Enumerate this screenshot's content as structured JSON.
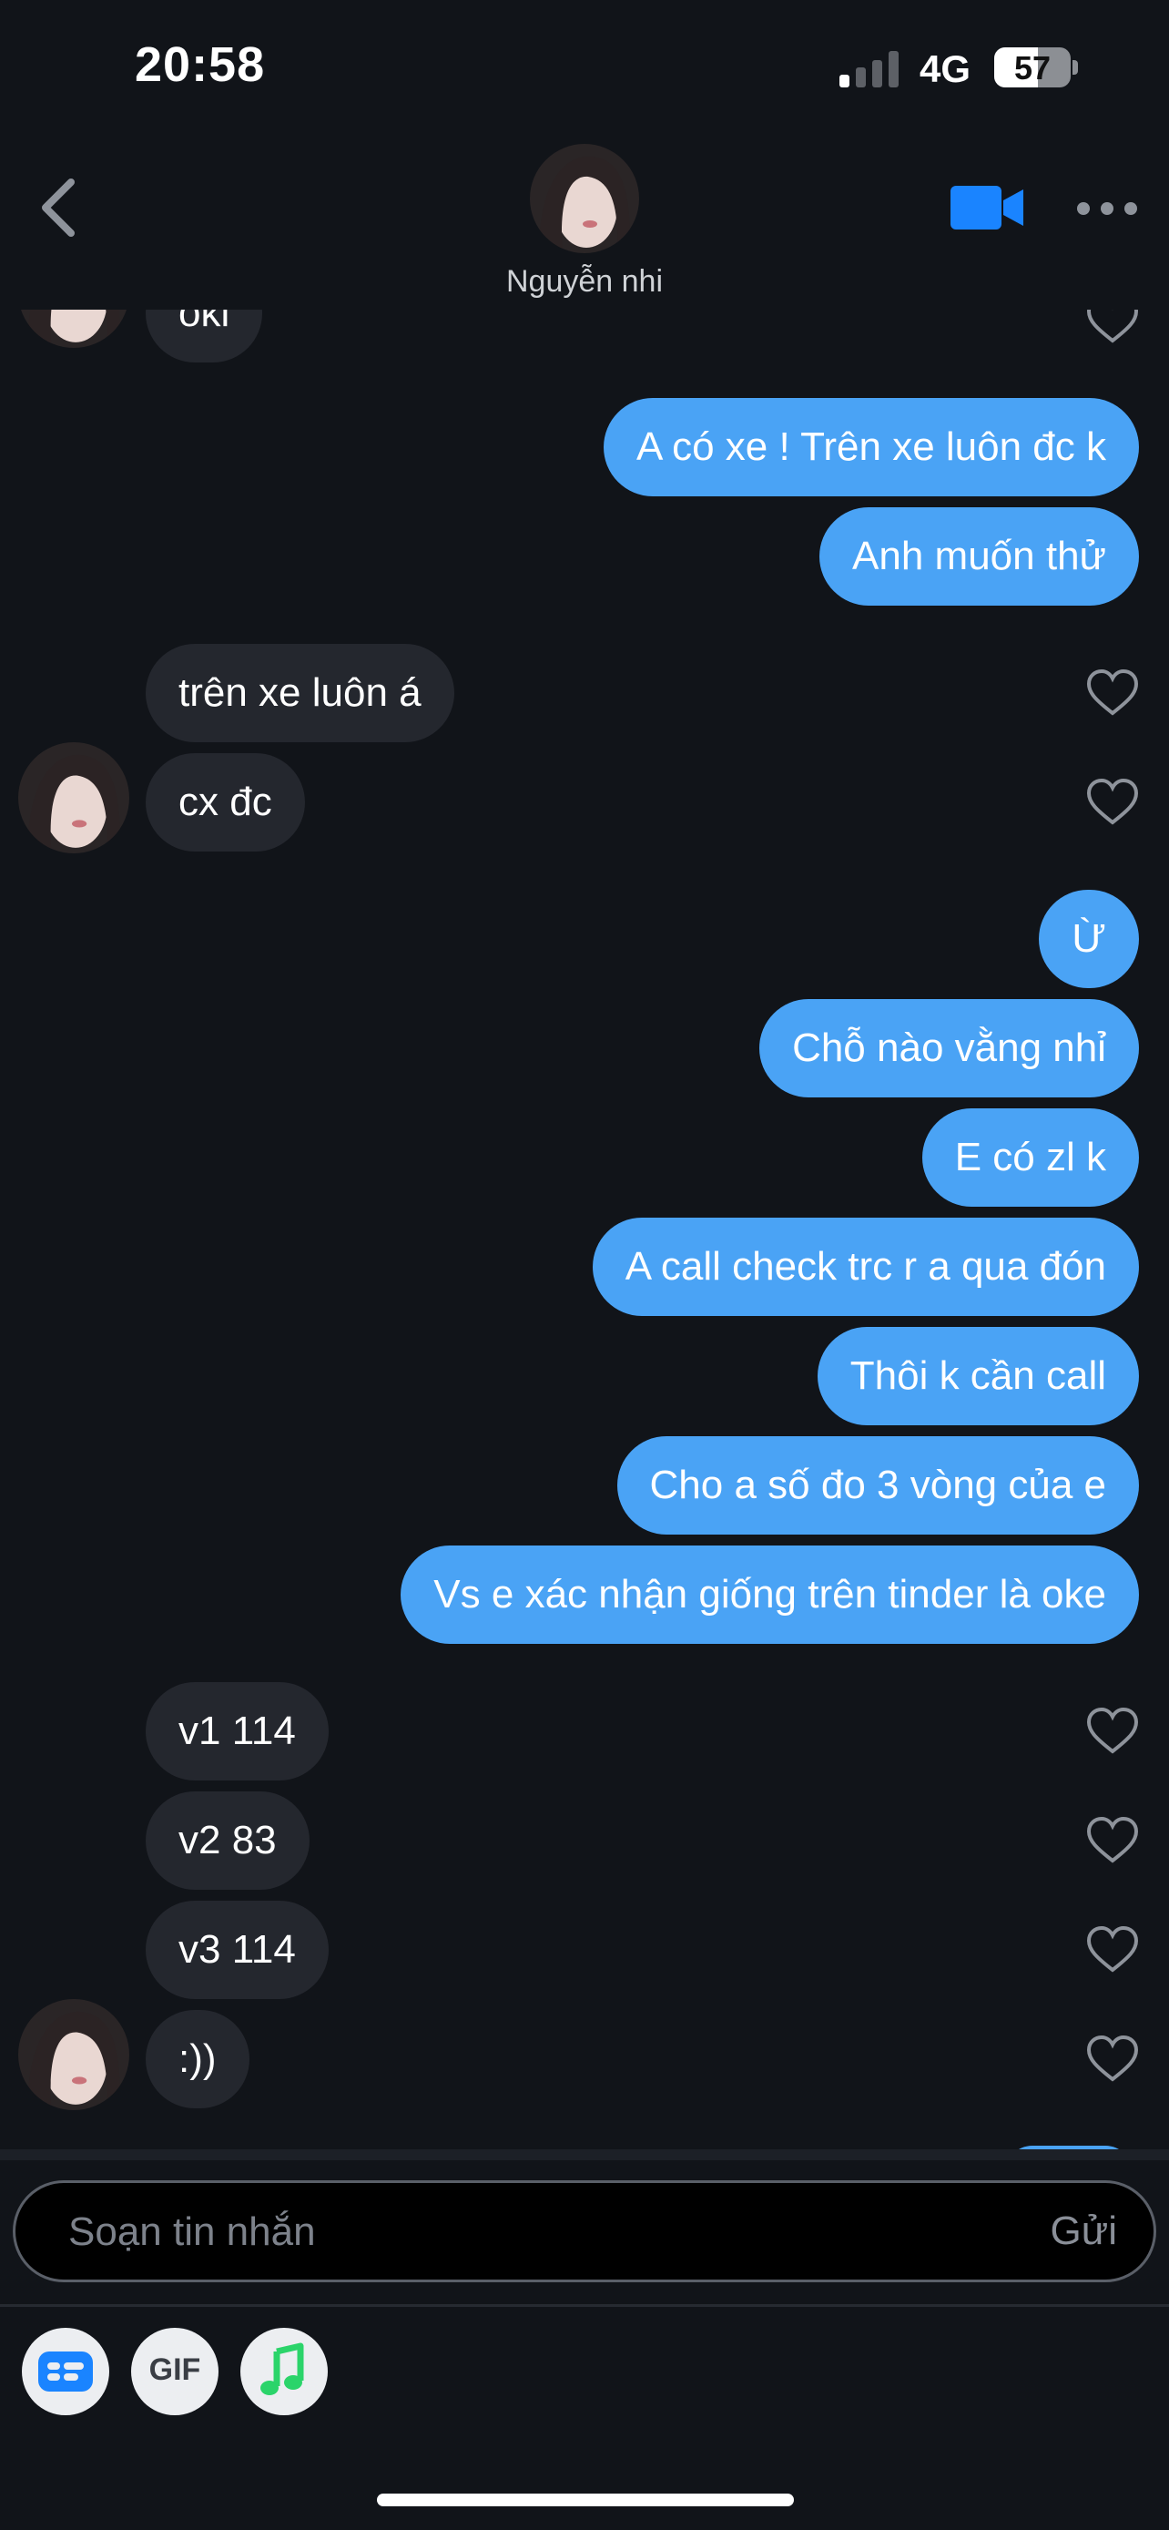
{
  "status_bar": {
    "time": "20:58",
    "network": "4G",
    "battery": "57",
    "battery_level": 0.57
  },
  "header": {
    "contact_name": "Nguyễn nhi",
    "back_icon": "chevron-left-icon",
    "video_icon": "video-camera-icon",
    "more_icon": "more-horizontal-icon"
  },
  "messages": {
    "top_partial": "oki",
    "m1": "A có xe ! Trên xe luôn đc k",
    "m2": "Anh muốn thử",
    "m3": "trên xe luôn á",
    "m4": "cx đc",
    "m5": "Ừ",
    "m6": "Chỗ nào vằng nhỉ",
    "m7": "E có zl k",
    "m8": "A call check trc r a qua đón",
    "m9": "Thôi k cần call",
    "m10": "Cho a số đo 3 vòng của e",
    "m11": "Vs e xác nhận giống trên tinder là oke",
    "m12": "v1 114",
    "m13": "v2 83",
    "m14": "v3 114",
    "m15": ":))"
  },
  "composer": {
    "placeholder": "Soạn tin nhắn",
    "send_label": "Gửi"
  },
  "toolbar": {
    "gif_label": "GIF",
    "sticker_icon": "card-icon",
    "music_icon": "music-note-icon"
  },
  "colors": {
    "background": "#111419",
    "incoming_bubble": "#24272e",
    "outgoing_bubble": "#4aa3f5",
    "accent": "#1a84ff"
  }
}
